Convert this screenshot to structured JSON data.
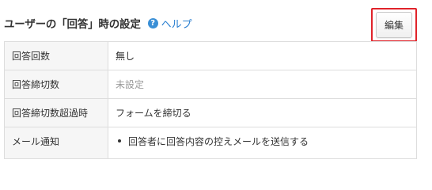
{
  "header": {
    "title": "ユーザーの「回答」時の設定",
    "help_icon_glyph": "?",
    "help_label": "ヘルプ"
  },
  "toolbar": {
    "edit_label": "編集"
  },
  "settings": {
    "rows": [
      {
        "label": "回答回数",
        "value": "無し"
      },
      {
        "label": "回答締切数",
        "value": "未設定"
      },
      {
        "label": "回答締切数超過時",
        "value": "フォームを締切る"
      },
      {
        "label": "メール通知",
        "items": [
          "回答者に回答内容の控えメールを送信する"
        ]
      }
    ]
  },
  "colors": {
    "highlight": "#e0232a",
    "link": "#2a7fd0",
    "help_icon": "#3a8fd6",
    "muted_text": "#999999"
  }
}
